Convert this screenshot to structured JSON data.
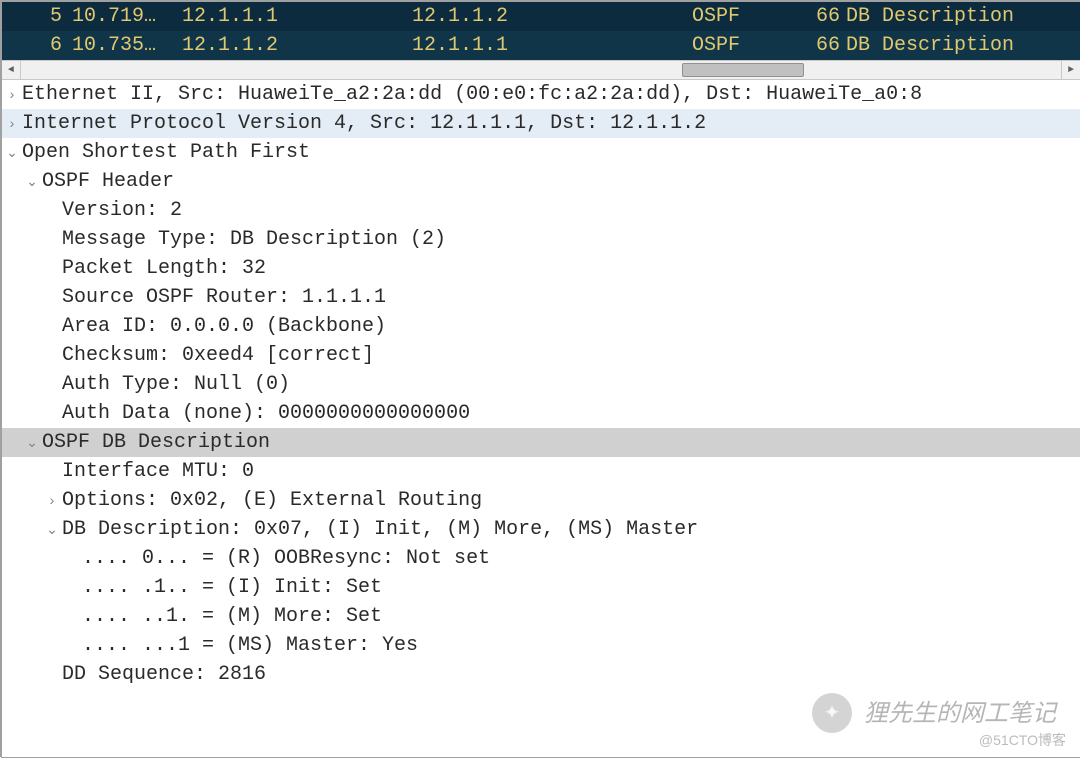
{
  "packets": [
    {
      "no": "5",
      "time": "10.719…",
      "src": "12.1.1.1",
      "dst": "12.1.1.2",
      "proto": "OSPF",
      "len": "66",
      "info": "DB Description"
    },
    {
      "no": "6",
      "time": "10.735…",
      "src": "12.1.1.2",
      "dst": "12.1.1.1",
      "proto": "OSPF",
      "len": "66",
      "info": "DB Description"
    }
  ],
  "tw": {
    "right": "›",
    "down": "⌄"
  },
  "detail": {
    "eth": "Ethernet II, Src: HuaweiTe_a2:2a:dd (00:e0:fc:a2:2a:dd), Dst: HuaweiTe_a0:8",
    "ip": "Internet Protocol Version 4, Src: 12.1.1.1, Dst: 12.1.1.2",
    "ospf": "Open Shortest Path First",
    "hdr": "OSPF Header",
    "ver": "Version: 2",
    "mtype": "Message Type: DB Description (2)",
    "plen": "Packet Length: 32",
    "srcr": "Source OSPF Router: 1.1.1.1",
    "area": "Area ID: 0.0.0.0 (Backbone)",
    "csum": "Checksum: 0xeed4 [correct]",
    "atype": "Auth Type: Null (0)",
    "adata": "Auth Data (none): 0000000000000000",
    "dbd": "OSPF DB Description",
    "mtu": "Interface MTU: 0",
    "opts": "Options: 0x02, (E) External Routing",
    "dbdesc": "DB Description: 0x07, (I) Init, (M) More, (MS) Master",
    "bit_r": ".... 0... = (R) OOBResync: Not set",
    "bit_i": ".... .1.. = (I) Init: Set",
    "bit_m": ".... ..1. = (M) More: Set",
    "bit_ms": ".... ...1 = (MS) Master: Yes",
    "ddseq": "DD Sequence: 2816"
  },
  "watermark": {
    "text": "狸先生的网工笔记",
    "bubble": "✦"
  },
  "credit": "@51CTO博客"
}
